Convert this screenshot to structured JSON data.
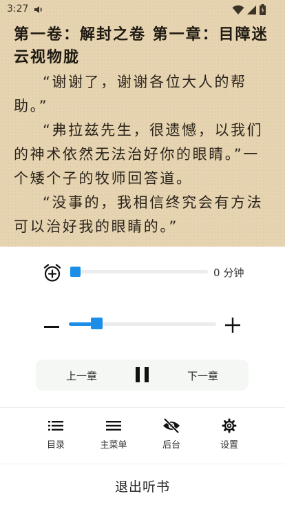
{
  "status_bar": {
    "time": "3:27"
  },
  "reader": {
    "chapter_title": "第一卷：解封之卷 第一章：目障迷云视物胧",
    "paragraphs": [
      "“谢谢了，谢谢各位大人的帮助。”",
      "“弗拉兹先生，很遗憾，以我们的神术依然无法治好你的眼睛。”一个矮个子的牧师回答道。",
      "“没事的，我相信终究会有方法可以治好我的眼睛的。”"
    ]
  },
  "timer": {
    "value": "0",
    "unit": "分钟",
    "fraction": 0.0
  },
  "speed": {
    "fraction": 0.15
  },
  "chapter_controls": {
    "prev_label": "上一章",
    "next_label": "下一章"
  },
  "nav": {
    "items": [
      {
        "label": "目录",
        "icon": "toc-icon"
      },
      {
        "label": "主菜单",
        "icon": "menu-icon"
      },
      {
        "label": "后台",
        "icon": "eye-off-icon"
      },
      {
        "label": "设置",
        "icon": "gear-icon"
      }
    ]
  },
  "exit_label": "退出听书",
  "colors": {
    "accent": "#1a8ee8",
    "page_background": "#e6d3b0"
  }
}
